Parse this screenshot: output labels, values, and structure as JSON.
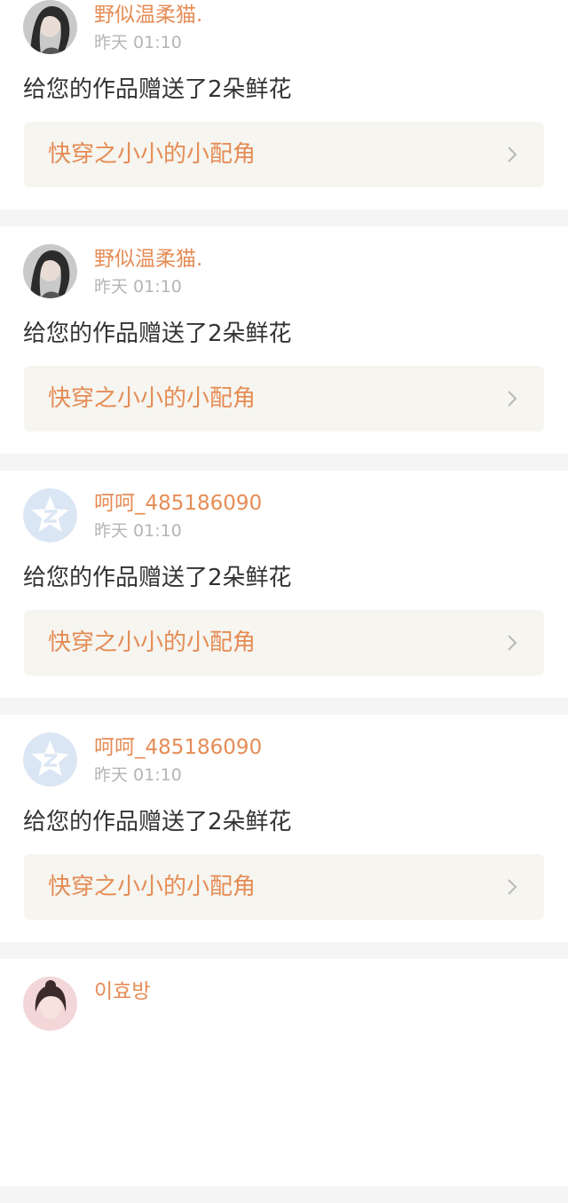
{
  "feed": [
    {
      "username": "野似温柔猫.",
      "time": "昨天 01:10",
      "message": "给您的作品赠送了2朵鲜花",
      "work_title": "快穿之小小的小配角",
      "avatar_icon": "user-photo-dark-hair"
    },
    {
      "username": "野似温柔猫.",
      "time": "昨天 01:10",
      "message": "给您的作品赠送了2朵鲜花",
      "work_title": "快穿之小小的小配角",
      "avatar_icon": "user-photo-dark-hair"
    },
    {
      "username": "呵呵_485186090",
      "time": "昨天 01:10",
      "message": "给您的作品赠送了2朵鲜花",
      "work_title": "快穿之小小的小配角",
      "avatar_icon": "default-star-avatar"
    },
    {
      "username": "呵呵_485186090",
      "time": "昨天 01:10",
      "message": "给您的作品赠送了2朵鲜花",
      "work_title": "快穿之小小的小配角",
      "avatar_icon": "default-star-avatar"
    },
    {
      "username": "이효방",
      "avatar_icon": "user-photo-pink"
    }
  ],
  "colors": {
    "accent": "#e58c55",
    "text": "#333333",
    "muted": "#b5b5b5",
    "work_box_bg": "#f6f5f0",
    "page_bg": "#f5f5f5"
  }
}
